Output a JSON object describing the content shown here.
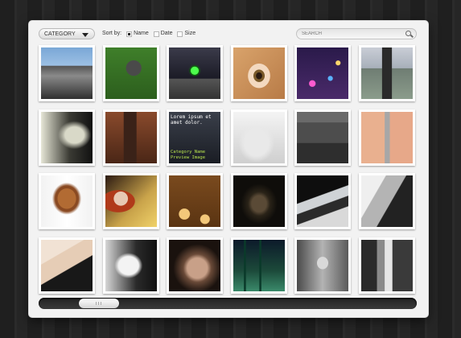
{
  "toolbar": {
    "category_label": "CATEGORY",
    "sort_label": "Sort by:",
    "sort_options": [
      {
        "label": "Name",
        "checked": true
      },
      {
        "label": "Date",
        "checked": false
      },
      {
        "label": "Size",
        "checked": false
      }
    ],
    "search_placeholder": "SEARCH"
  },
  "gallery": {
    "thumbnails": [
      {
        "scene": "bridge-icon",
        "bg": "linear-gradient(#7aa7d6 0%,#9cc0e4 35%,#555 36%,#8a8a8a 55%,#2f2f2f 100%)"
      },
      {
        "scene": "golfer-icon",
        "bg": "radial-gradient(circle at 55% 40%,#4a4a4a 0 18%,transparent 19%), linear-gradient(#3f7f2a,#2c5e1d)"
      },
      {
        "scene": "traffic-light-icon",
        "bg": "radial-gradient(circle at 50% 45%,#4dff4d 0 10%,#0b6b0b 11%,transparent 16%), linear-gradient(#3b3b4a,#1b1b26 60%,#555 61%,#333)"
      },
      {
        "scene": "eye-icon",
        "bg": "radial-gradient(ellipse at 50% 55%,#2a1a10 0 8%,#7a5a2a 9% 15%,#f3d9c0 16% 30%,transparent 31%), linear-gradient(135deg,#d9a36b,#b87b47)"
      },
      {
        "scene": "city-lights-icon",
        "bg": "radial-gradient(circle at 30% 70%,#ff5bd0 0 6%,transparent 7%), radial-gradient(circle at 65% 60%,#5ab2ff 0 5%,transparent 6%), radial-gradient(circle at 80% 30%,#ffd76b 0 4%,transparent 5%), linear-gradient(#2a1a4a,#4a2a6a)"
      },
      {
        "scene": "road-icon",
        "bg": "linear-gradient(90deg,transparent 40%,#2a2a2a 41% 59%,transparent 60%), linear-gradient(#c9cdd6 0%,#a8b0ba 40%,#6f7d73 41%,#8b9c8b 100%)"
      },
      {
        "scene": "hair-portrait-icon",
        "bg": "radial-gradient(ellipse at 65% 45%,#d9d9c8 0 20%,transparent 35%), linear-gradient(90deg,#e6e6d6,#3b3b34 55%,#111)"
      },
      {
        "scene": "tree-stump-icon",
        "bg": "linear-gradient(90deg,transparent 35%,#3a2218 36% 60%,transparent 61%), linear-gradient(#8a4a2c,#4a2616)"
      },
      {
        "scene": "text-preview",
        "bg": "linear-gradient(#3a3f4a,#1a1d24)",
        "caption": "Lorem ipsum et amet dolor.",
        "category": "Category Name",
        "preview": "Preview Image"
      },
      {
        "scene": "tree-face-icon",
        "bg": "radial-gradient(ellipse at 45% 60%,#e9e9e9 0 30%,transparent 45%), linear-gradient(#f4f4f4,#cfcfcf)"
      },
      {
        "scene": "building-icon",
        "bg": "linear-gradient(#6a6a6a 0 20%,#4d4d4d 21% 60%,#2e2e2e 61%), linear-gradient(#777,#333)"
      },
      {
        "scene": "torn-jeans-icon",
        "bg": "linear-gradient(90deg,#e9b08f 0 45%,#a7a7a7 46% 55%,#e7a889 56%), linear-gradient(#e5a17d,#c98461)"
      },
      {
        "scene": "angel-hair-icon",
        "bg": "radial-gradient(ellipse at 50% 45%,#b26b33 0 25%,#8a4a22 26% 32%,transparent 40%), linear-gradient(90deg,#f2f2f2,#fff 50%,#f2f2f2)"
      },
      {
        "scene": "woman-portrait-icon",
        "bg": "radial-gradient(circle at 30% 45%,#e7c9b4 0 15%,transparent 16%), radial-gradient(ellipse at 25% 50%,#b03a1a 0 30%,transparent 31%), linear-gradient(135deg,#2b1a12,#c9a34a 60%,#f0d26a)"
      },
      {
        "scene": "floral-icon",
        "bg": "radial-gradient(circle at 30% 75%,#f3c87a 0 10%,transparent 11%), radial-gradient(circle at 70% 85%,#f3c87a 0 8%,transparent 9%), linear-gradient(#7a4a1e,#5a3412)"
      },
      {
        "scene": "skull-icon",
        "bg": "radial-gradient(ellipse at 50% 55%,#5a4a36 0 20%,#2a2318 30%,#0f0d0a 50%), #111"
      },
      {
        "scene": "sneaker-icon",
        "bg": "linear-gradient(160deg,#0e0e0e 0 40%,#cfd3d6 41% 55%,#2b2b2b 56% 70%,#d9d9d9 71%)"
      },
      {
        "scene": "car-woman-icon",
        "bg": "linear-gradient(120deg,#efefef 0 30%,#b4b4b4 31% 55%,#222 56%), #ccc"
      },
      {
        "scene": "legs-icon",
        "bg": "linear-gradient(150deg,#f1e2d4 0 30%,#e6cdb6 31% 55%,#181818 56%)"
      },
      {
        "scene": "hands-icon",
        "bg": "radial-gradient(ellipse at 45% 50%,#f3f3f3 0 25%,transparent 35%), linear-gradient(90deg,#d6d6d6,#2a2a2a 60%,#111)"
      },
      {
        "scene": "face-closeup-icon",
        "bg": "radial-gradient(ellipse at 55% 55%,#c8a088 0 25%,#6a4a38 35%,#1a120e 60%), #2a1f18"
      },
      {
        "scene": "forest-icon",
        "bg": "linear-gradient(90deg,transparent 20%,#0a3a2a 21% 24%,transparent 25% 50%,#0a3a2a 51% 54%,transparent 55%), linear-gradient(#0c1a2a,#1c4a3a 60%,#3a8a6a)"
      },
      {
        "scene": "girl-portrait-icon",
        "bg": "radial-gradient(ellipse at 50% 45%,#d9d9d9 0 15%,transparent 16%), linear-gradient(90deg,#4a4a4a,#b3b3b3 50%,#5a5a5a)"
      },
      {
        "scene": "wedding-couple-icon",
        "bg": "linear-gradient(90deg,#2a2a2a 0 30%,#8a8a8a 31% 45%,#e6e6e6 46% 60%,#3a3a3a 61%)"
      }
    ]
  },
  "scroll": {
    "position": 0.12
  }
}
